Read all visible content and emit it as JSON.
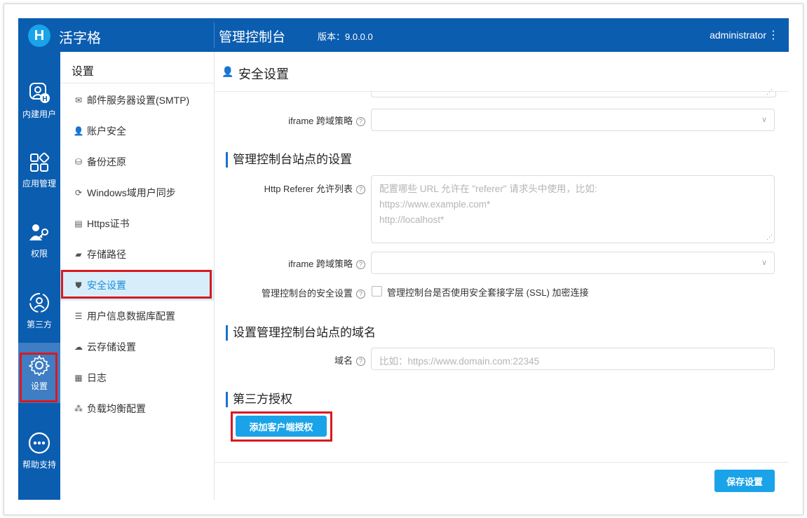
{
  "header": {
    "logo_letter": "H",
    "brand": "活字格",
    "console_title": "管理控制台",
    "version": "版本：9.0.0.0",
    "user": "administrator",
    "menu_glyph": "⋮"
  },
  "leftnav": {
    "items": [
      {
        "label": "内建用户",
        "icon": "builtin-user-icon"
      },
      {
        "label": "应用管理",
        "icon": "apps-icon"
      },
      {
        "label": "权限",
        "icon": "permission-icon"
      },
      {
        "label": "第三方",
        "icon": "third-party-icon"
      },
      {
        "label": "设置",
        "icon": "gear-icon"
      },
      {
        "label": "帮助支持",
        "icon": "more-icon"
      }
    ],
    "active_index": 4
  },
  "subnav": {
    "title": "设置",
    "items": [
      {
        "label": "邮件服务器设置(SMTP)",
        "icon": "mail-icon"
      },
      {
        "label": "账户安全",
        "icon": "account-security-icon"
      },
      {
        "label": "备份还原",
        "icon": "backup-icon"
      },
      {
        "label": "Windows域用户同步",
        "icon": "sync-icon"
      },
      {
        "label": "Https证书",
        "icon": "certificate-icon"
      },
      {
        "label": "存储路径",
        "icon": "folder-icon"
      },
      {
        "label": "安全设置",
        "icon": "shield-icon"
      },
      {
        "label": "用户信息数据库配置",
        "icon": "database-icon"
      },
      {
        "label": "云存储设置",
        "icon": "cloud-icon"
      },
      {
        "label": "日志",
        "icon": "log-icon"
      },
      {
        "label": "负载均衡配置",
        "icon": "load-balance-icon"
      }
    ],
    "active_index": 6
  },
  "main": {
    "title": "安全设置",
    "iframe_label_1": "iframe 跨域策略",
    "section_console_site": "管理控制台站点的设置",
    "referer_label": "Http Referer 允许列表",
    "referer_placeholder": "配置哪些 URL 允许在 \"referer\" 请求头中使用，比如:\nhttps://www.example.com*\nhttp://localhost*",
    "iframe_label_2": "iframe 跨域策略",
    "console_security_label": "管理控制台的安全设置",
    "ssl_checkbox_label": "管理控制台是否使用安全套接字层 (SSL) 加密连接",
    "ssl_checked": false,
    "section_domain": "设置管理控制台站点的域名",
    "domain_label": "域名",
    "domain_placeholder": "比如：https://www.domain.com:22345",
    "section_third_party": "第三方授权",
    "add_client_button": "添加客户端授权",
    "save_button": "保存设置"
  },
  "colors": {
    "header_bg": "#0b5db0",
    "accent": "#1aa3e8",
    "highlight_border": "#d9191f",
    "active_sub_bg": "#d7eefa"
  }
}
